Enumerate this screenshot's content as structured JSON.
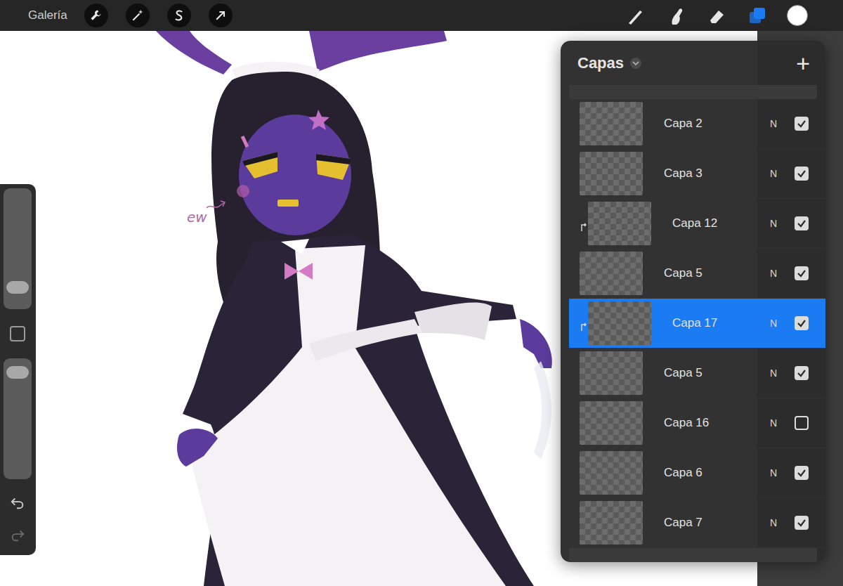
{
  "toolbar": {
    "gallery": "Galería",
    "tools": [
      {
        "kind": "brush",
        "selected": false
      },
      {
        "kind": "smudge",
        "selected": false
      },
      {
        "kind": "eraser",
        "selected": false
      },
      {
        "kind": "layers",
        "selected": true
      }
    ],
    "color": "#ffffff"
  },
  "sidebar": {
    "size_level": 0.14,
    "opacity_level": 0.93
  },
  "canvas": {
    "annotation": "ew"
  },
  "layers_panel": {
    "title": "Capas",
    "add": "+",
    "layers": [
      {
        "name": "Capa 2",
        "blend": "N",
        "visible": true,
        "selected": false,
        "clipped": false
      },
      {
        "name": "Capa 3",
        "blend": "N",
        "visible": true,
        "selected": false,
        "clipped": false
      },
      {
        "name": "Capa 12",
        "blend": "N",
        "visible": true,
        "selected": false,
        "clipped": true
      },
      {
        "name": "Capa 5",
        "blend": "N",
        "visible": true,
        "selected": false,
        "clipped": false
      },
      {
        "name": "Capa 17",
        "blend": "N",
        "visible": true,
        "selected": true,
        "clipped": true
      },
      {
        "name": "Capa 5",
        "blend": "N",
        "visible": true,
        "selected": false,
        "clipped": false
      },
      {
        "name": "Capa 16",
        "blend": "N",
        "visible": false,
        "selected": false,
        "clipped": false
      },
      {
        "name": "Capa 6",
        "blend": "N",
        "visible": true,
        "selected": false,
        "clipped": false
      },
      {
        "name": "Capa 7",
        "blend": "N",
        "visible": true,
        "selected": false,
        "clipped": false
      }
    ]
  }
}
